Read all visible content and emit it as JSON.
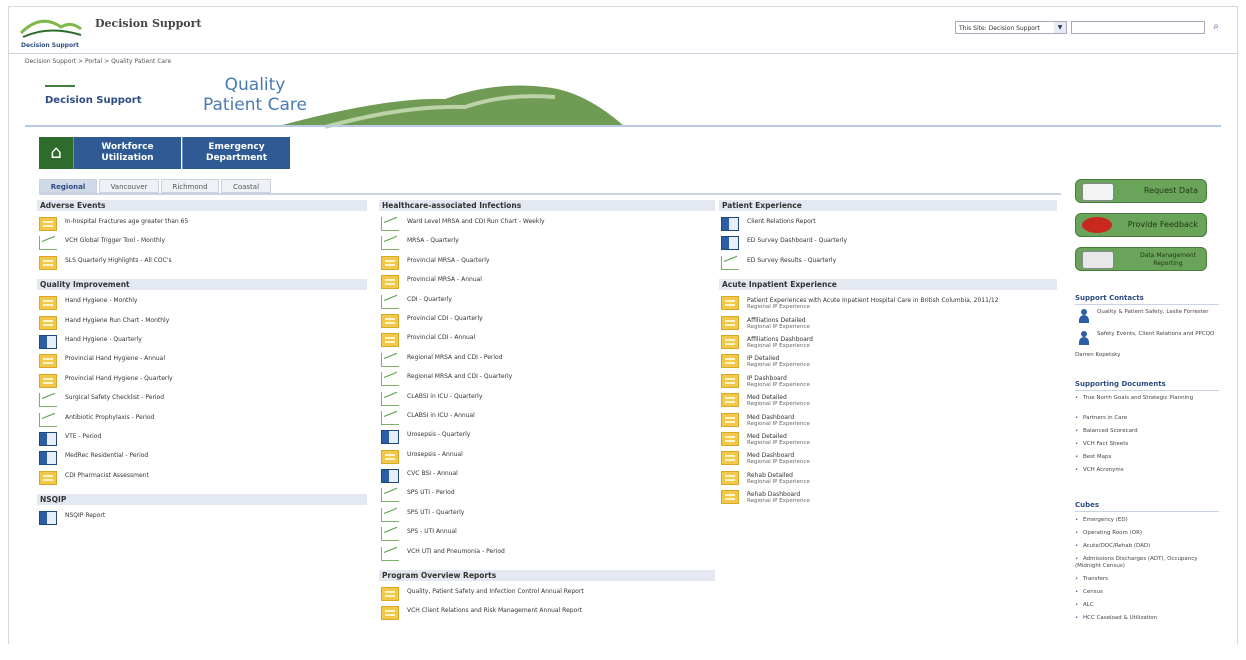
{
  "header": {
    "app_title": "Decision Support",
    "logo_text": "Decision Support",
    "scope_value": "This Site: Decision Support",
    "search_placeholder": "",
    "breadcrumb": "Decision Support > Portal > Quality Patient Care"
  },
  "banner": {
    "logo_text": "Decision Support",
    "title_line1": "Quality",
    "title_line2": "Patient Care"
  },
  "nav_tiles": [
    {
      "line1": "Workforce",
      "line2": "Utilization"
    },
    {
      "line1": "Emergency",
      "line2": "Department"
    }
  ],
  "tabs": [
    "Regional",
    "Vancouver",
    "Richmond",
    "Coastal"
  ],
  "active_tab": "Regional",
  "col1": {
    "sections": [
      {
        "title": "Adverse Events",
        "items": [
          {
            "icon": "yellow",
            "label": "In-hospital Fractures age greater than 65"
          },
          {
            "icon": "green",
            "label": "VCH Global Trigger Tool - Monthly"
          },
          {
            "icon": "yellow",
            "label": "SLS Quarterly Highlights - All COC's"
          }
        ]
      },
      {
        "title": "Quality Improvement",
        "items": [
          {
            "icon": "yellow",
            "label": "Hand Hygiene - Monthly"
          },
          {
            "icon": "yellow",
            "label": "Hand Hygiene Run Chart - Monthly"
          },
          {
            "icon": "blue",
            "label": "Hand Hygiene - Quarterly"
          },
          {
            "icon": "yellow",
            "label": "Provincial Hand Hygiene - Annual"
          },
          {
            "icon": "yellow",
            "label": "Provincial Hand Hygiene - Quarterly"
          },
          {
            "icon": "green",
            "label": "Surgical Safety Checklist - Period"
          },
          {
            "icon": "green",
            "label": "Antibiotic Prophylaxis - Period"
          },
          {
            "icon": "blue",
            "label": "VTE - Period"
          },
          {
            "icon": "blue",
            "label": "MedRec Residential - Period"
          },
          {
            "icon": "yellow",
            "label": "CDI Pharmacist Assessment"
          }
        ]
      },
      {
        "title": "NSQIP",
        "items": [
          {
            "icon": "blue",
            "label": "NSQIP Report"
          }
        ]
      }
    ]
  },
  "col2": {
    "sections": [
      {
        "title": "Healthcare-associated Infections",
        "items": [
          {
            "icon": "green",
            "label": "Ward Level MRSA and CDI Run Chart - Weekly"
          },
          {
            "icon": "green",
            "label": "MRSA - Quarterly"
          },
          {
            "icon": "yellow",
            "label": "Provincial MRSA - Quarterly"
          },
          {
            "icon": "yellow",
            "label": "Provincial MRSA - Annual"
          },
          {
            "icon": "green",
            "label": "CDI - Quarterly"
          },
          {
            "icon": "yellow",
            "label": "Provincial CDI - Quarterly"
          },
          {
            "icon": "yellow",
            "label": "Provincial CDI - Annual"
          },
          {
            "icon": "green",
            "label": "Regional MRSA and CDI - Period"
          },
          {
            "icon": "green",
            "label": "Regional MRSA and CDI - Quarterly"
          },
          {
            "icon": "green",
            "label": "CLABSI in ICU - Quarterly"
          },
          {
            "icon": "green",
            "label": "CLABSI in ICU - Annual"
          },
          {
            "icon": "blue",
            "label": "Urosepsis - Quarterly"
          },
          {
            "icon": "yellow",
            "label": "Urosepsis - Annual"
          },
          {
            "icon": "blue",
            "label": "CVC BSI - Annual"
          },
          {
            "icon": "green",
            "label": "SPS UTI - Period"
          },
          {
            "icon": "green",
            "label": "SPS UTI - Quarterly"
          },
          {
            "icon": "green",
            "label": "SPS - UTI Annual"
          },
          {
            "icon": "green",
            "label": "VCH UTI and Pneumonia - Period"
          }
        ]
      },
      {
        "title": "Program Overview Reports",
        "items": [
          {
            "icon": "yellow",
            "label": "Quality, Patient Safety and Infection Control Annual Report"
          },
          {
            "icon": "yellow",
            "label": "VCH Client Relations and Risk Management Annual Report"
          }
        ]
      }
    ]
  },
  "col3": {
    "sections": [
      {
        "title": "Patient Experience",
        "items": [
          {
            "icon": "blue",
            "label": "Client Relations Report"
          },
          {
            "icon": "blue",
            "label": "ED Survey Dashboard - Quarterly"
          },
          {
            "icon": "green",
            "label": "ED Survey Results - Quarterly"
          }
        ]
      },
      {
        "title": "Acute Inpatient Experience",
        "items": [
          {
            "icon": "yellow",
            "label": "Patient Experiences with Acute Inpatient Hospital Care in British Columbia, 2011/12",
            "sub": "Regional IP Experience"
          },
          {
            "icon": "yellow",
            "label": "Affiliations Detailed",
            "sub": "Regional IP Experience"
          },
          {
            "icon": "yellow",
            "label": "Affiliations Dashboard",
            "sub": "Regional IP Experience"
          },
          {
            "icon": "yellow",
            "label": "IP Detailed",
            "sub": "Regional IP Experience"
          },
          {
            "icon": "yellow",
            "label": "IP Dashboard",
            "sub": "Regional IP Experience"
          },
          {
            "icon": "yellow",
            "label": "Med Detailed",
            "sub": "Regional IP Experience"
          },
          {
            "icon": "yellow",
            "label": "Med Dashboard",
            "sub": "Regional IP Experience"
          },
          {
            "icon": "yellow",
            "label": "Med Detailed",
            "sub": "Regional IP Experience"
          },
          {
            "icon": "yellow",
            "label": "Med Dashboard",
            "sub": "Regional IP Experience"
          },
          {
            "icon": "yellow",
            "label": "Rehab Detailed",
            "sub": "Regional IP Experience"
          },
          {
            "icon": "yellow",
            "label": "Rehab Dashboard",
            "sub": "Regional IP Experience"
          }
        ]
      }
    ]
  },
  "right": {
    "buttons": [
      "Request Data",
      "Provide Feedback",
      "Data Management Reporting"
    ],
    "support_contacts_title": "Support Contacts",
    "contacts": [
      {
        "line": "Quality & Patient Safety, Leslie Forrester"
      },
      {
        "line": "Safety Events, Client Relations and PPCQO",
        "extra": "Darren Kopetsky"
      }
    ],
    "supporting_docs_title": "Supporting Documents",
    "supporting_docs": [
      "True North Goals and Strategic Planning",
      "Partners in Care",
      "Balanced Scorecard",
      "VCH Fact Sheets",
      "Best Maps",
      "VCH Acronyms"
    ],
    "cubes_title": "Cubes",
    "cubes": [
      "Emergency (ED)",
      "Operating Room (OR)",
      "Acute/DOC/Rehab (DAD)",
      "Admissions Discharges (ADT), Occupancy (Midnight Census)",
      "Transfers",
      "Census",
      "ALC",
      "HCC Caseload & Utilization"
    ]
  },
  "colors": {
    "nav_blue": "#2f5a93",
    "home_green": "#2f6b2c",
    "button_green": "#6aa35a",
    "section_bg": "#e4e9f1"
  }
}
